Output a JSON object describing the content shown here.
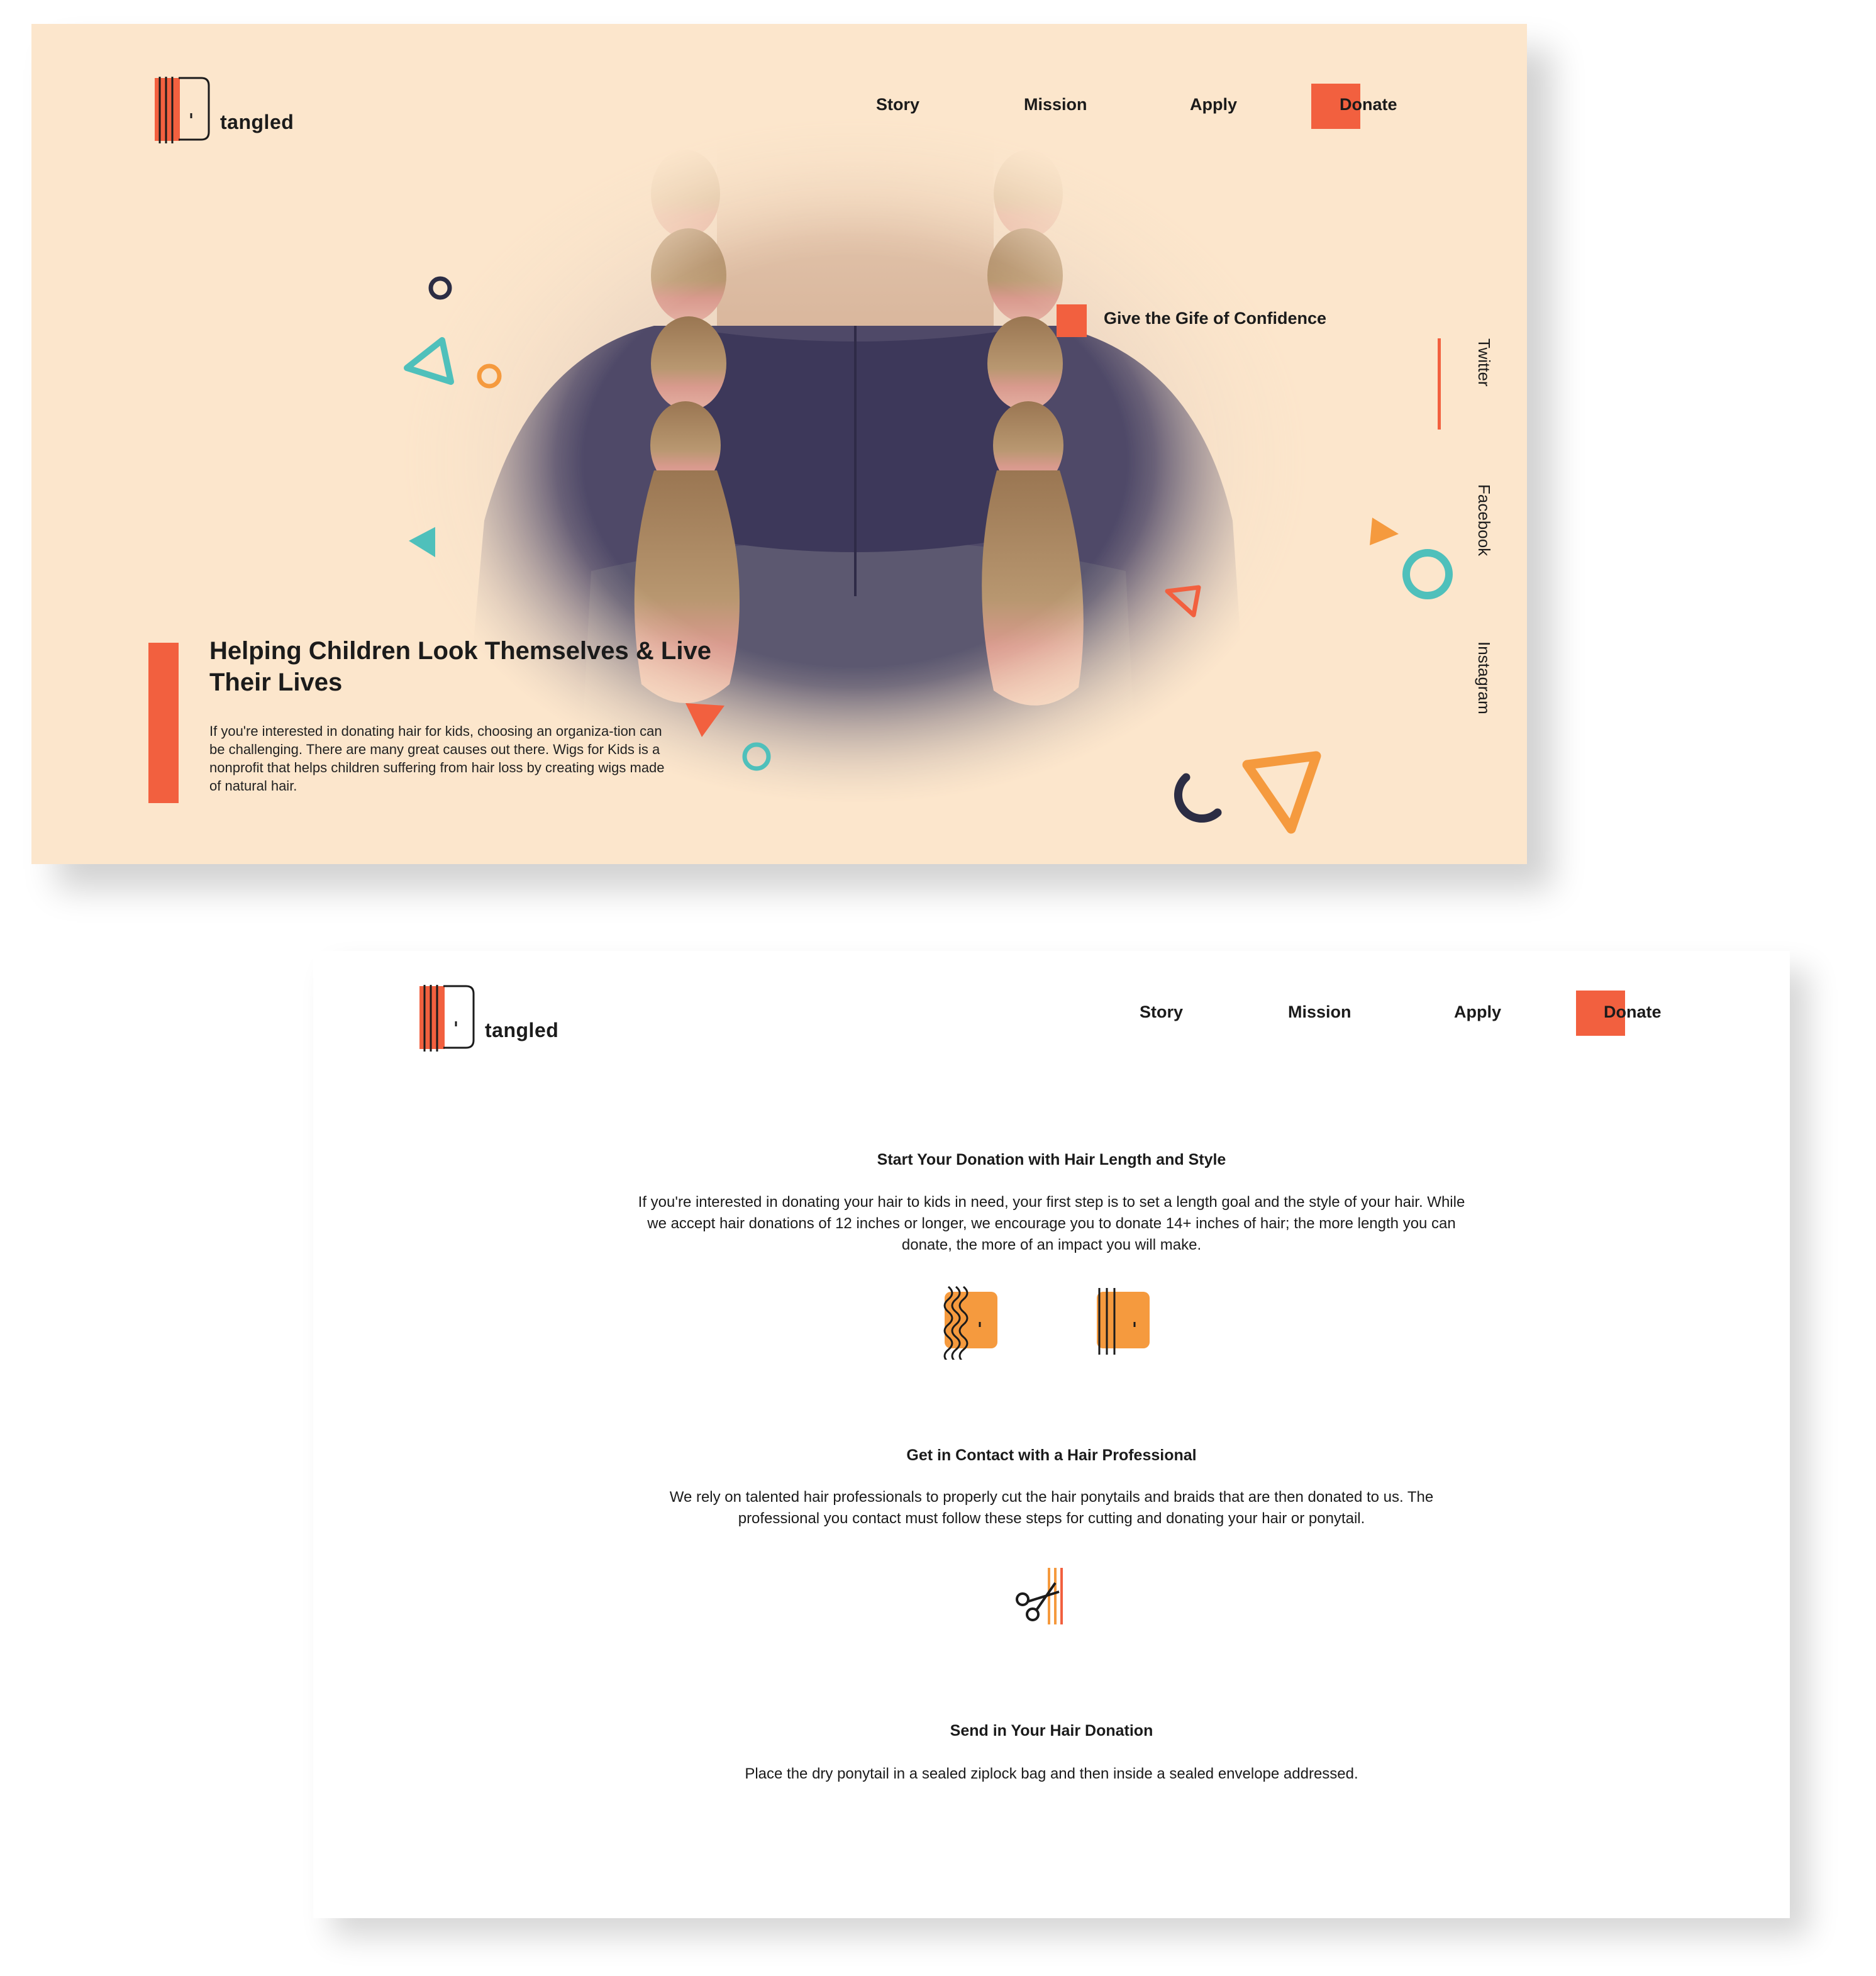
{
  "brand": {
    "name": "tangled",
    "accent": "#f2603f",
    "orange": "#f59a3e",
    "teal": "#4fc0bb",
    "navy": "#2c2d44",
    "peach_bg": "#fce6cc"
  },
  "nav": {
    "items": [
      {
        "label": "Story"
      },
      {
        "label": "Mission"
      },
      {
        "label": "Apply"
      },
      {
        "label": "Donate"
      }
    ]
  },
  "hero": {
    "title": "Helping Children Look Themselves & Live Their Lives",
    "body": "If you're interested in donating hair for kids, choosing an organiza-tion can be challenging. There are many great causes out there. Wigs for Kids is a nonprofit that helps children suffering from hair loss by creating wigs made of natural hair.",
    "tagline": "Give the Gife of Confidence",
    "photo_subject": "child-braids-photo"
  },
  "social": {
    "items": [
      {
        "label": "Twitter"
      },
      {
        "label": "Facebook"
      },
      {
        "label": "Instagram"
      }
    ]
  },
  "steps": [
    {
      "title": "Start Your Donation with Hair Length and Style",
      "body": "If you're interested in donating your hair to kids in need, your first step is to set a length goal and the style of your hair. While we accept hair donations of 12 inches or longer, we encourage you to donate 14+ inches of hair; the more length you can donate, the more of an impact you will make.",
      "icons": [
        "wavy-hair-icon",
        "straight-hair-icon"
      ]
    },
    {
      "title": "Get in Contact with a Hair Professional",
      "body": "We rely on talented hair professionals to properly cut the hair ponytails and braids that are then donated to us. The professional you contact must follow these steps for cutting and donating your hair or ponytail.",
      "icons": [
        "scissors-icon"
      ]
    },
    {
      "title": "Send in Your Hair Donation",
      "body": "Place the dry ponytail in a sealed ziplock bag and then inside a sealed envelope addressed."
    }
  ]
}
